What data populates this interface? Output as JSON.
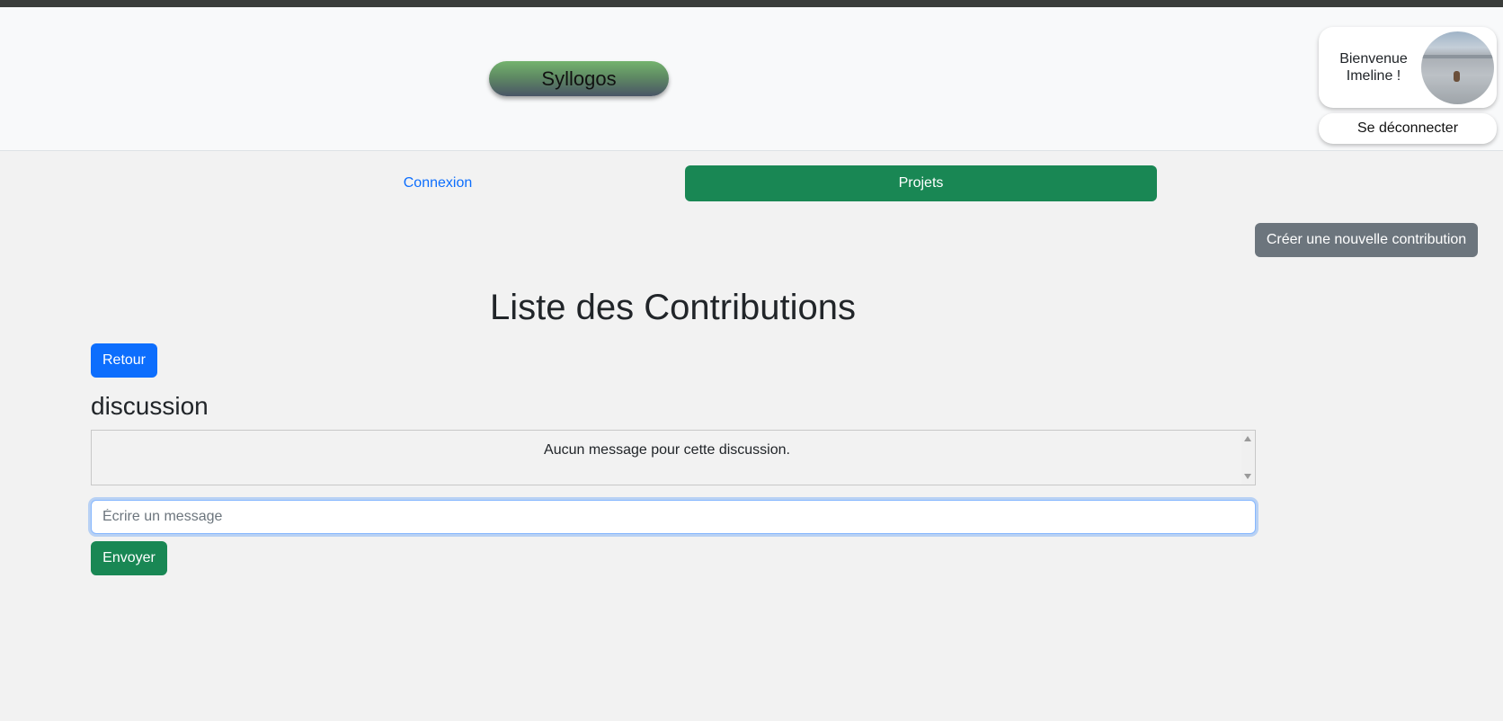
{
  "header": {
    "brand": "Syllogos",
    "user": {
      "greeting_line1": "Bienvenue",
      "greeting_line2": "Imeline !",
      "logout_label": "Se déconnecter"
    }
  },
  "nav": {
    "items": [
      {
        "label": "Connexion",
        "active": false
      },
      {
        "label": "Projets",
        "active": true
      }
    ]
  },
  "main": {
    "new_contribution_label": "Créer une nouvelle contribution",
    "title": "Liste des Contributions",
    "back_label": "Retour",
    "discussion": {
      "heading": "discussion",
      "empty_text": "Aucun message pour cette discussion.",
      "input_placeholder": "Écrire un message",
      "input_value": "",
      "send_label": "Envoyer"
    }
  },
  "colors": {
    "primary": "#0d6efd",
    "success": "#198754",
    "secondary": "#6c757d",
    "background": "#f2f2f2",
    "header_background": "#f8f9fa"
  }
}
